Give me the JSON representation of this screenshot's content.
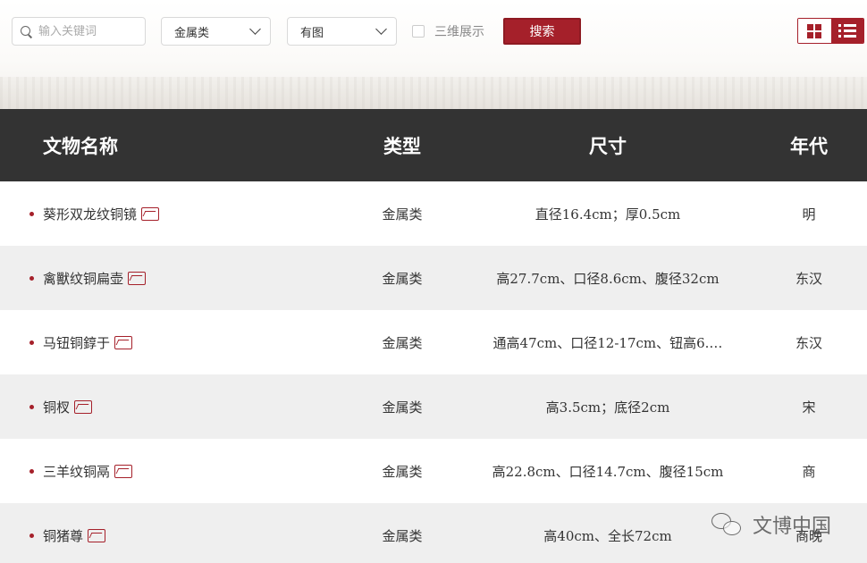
{
  "filters": {
    "search_placeholder": "输入关键词",
    "type_select": "金属类",
    "image_select": "有图",
    "three_d_label": "三维展示",
    "search_button": "搜索"
  },
  "view_toggle": {
    "active": "list"
  },
  "table": {
    "headers": {
      "name": "文物名称",
      "type": "类型",
      "size": "尺寸",
      "era": "年代"
    },
    "rows": [
      {
        "name": "葵形双龙纹铜镜",
        "type": "金属类",
        "size": "直径16.4cm；厚0.5cm",
        "era": "明"
      },
      {
        "name": "禽獸纹铜扁壶",
        "type": "金属类",
        "size": "高27.7cm、口径8.6cm、腹径32cm",
        "era": "东汉"
      },
      {
        "name": "马钮铜錞于",
        "type": "金属类",
        "size": "通高47cm、口径12-17cm、钮高6.…",
        "era": "东汉"
      },
      {
        "name": "铜杈",
        "type": "金属类",
        "size": "高3.5cm；底径2cm",
        "era": "宋"
      },
      {
        "name": "三羊纹铜鬲",
        "type": "金属类",
        "size": "高22.8cm、口径14.7cm、腹径15cm",
        "era": "商"
      },
      {
        "name": "铜猪尊",
        "type": "金属类",
        "size": "高40cm、全长72cm",
        "era": "商晚"
      }
    ]
  },
  "watermark": "文博中国",
  "colors": {
    "accent": "#a5202a",
    "header_bg": "#333333",
    "row_alt": "#efefef"
  },
  "icons": [
    "search-icon",
    "chevron-down-icon",
    "grid-view-icon",
    "list-view-icon",
    "image-icon",
    "wechat-icon"
  ]
}
